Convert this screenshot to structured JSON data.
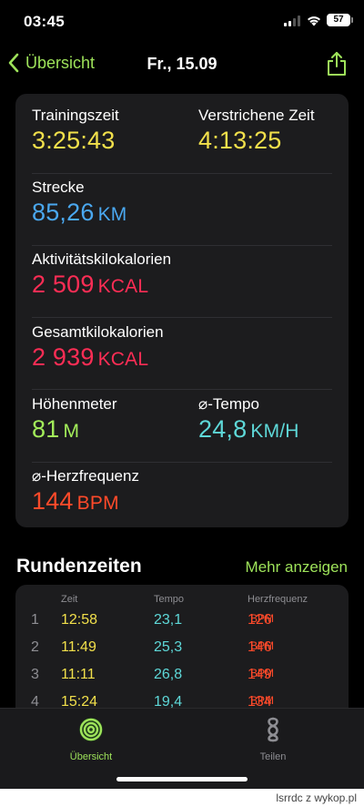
{
  "status_bar": {
    "time": "03:45",
    "battery": "57"
  },
  "nav": {
    "back_label": "Übersicht",
    "title": "Fr., 15.09"
  },
  "summary": {
    "trainingszeit": {
      "label": "Trainingszeit",
      "value": "3:25:43"
    },
    "verstrichene_zeit": {
      "label": "Verstrichene Zeit",
      "value": "4:13:25"
    },
    "strecke": {
      "label": "Strecke",
      "value": "85,26",
      "unit": "KM"
    },
    "aktiv_kcal": {
      "label": "Aktivitätskilokalorien",
      "value": "2 509",
      "unit": "KCAL"
    },
    "gesamt_kcal": {
      "label": "Gesamtkilokalorien",
      "value": "2 939",
      "unit": "KCAL"
    },
    "hoehenmeter": {
      "label": "Höhenmeter",
      "value": "81",
      "unit": "M"
    },
    "tempo": {
      "label": "⌀-Tempo",
      "value": "24,8",
      "unit": "KM/H"
    },
    "herzfrequenz": {
      "label": "⌀-Herzfrequenz",
      "value": "144",
      "unit": "BPM"
    }
  },
  "laps_section": {
    "title": "Rundenzeiten",
    "more": "Mehr anzeigen",
    "headers": {
      "zeit": "Zeit",
      "tempo": "Tempo",
      "hf": "Herzfrequenz"
    },
    "rows": [
      {
        "num": "1",
        "zeit": "12:58",
        "tempo": "23,1",
        "hf": "126",
        "unit": "BPM"
      },
      {
        "num": "2",
        "zeit": "11:49",
        "tempo": "25,3",
        "hf": "146",
        "unit": "BPM"
      },
      {
        "num": "3",
        "zeit": "11:11",
        "tempo": "26,8",
        "hf": "149",
        "unit": "BPM"
      },
      {
        "num": "4",
        "zeit": "15:24",
        "tempo": "19,4",
        "hf": "134",
        "unit": "BPM"
      }
    ]
  },
  "tabs": [
    {
      "label": "Übersicht",
      "icon": "activity-rings-icon"
    },
    {
      "label": "Teilen",
      "icon": "sharing-icon"
    }
  ],
  "footer": {
    "source": "lsrrdc z wykop.pl"
  }
}
